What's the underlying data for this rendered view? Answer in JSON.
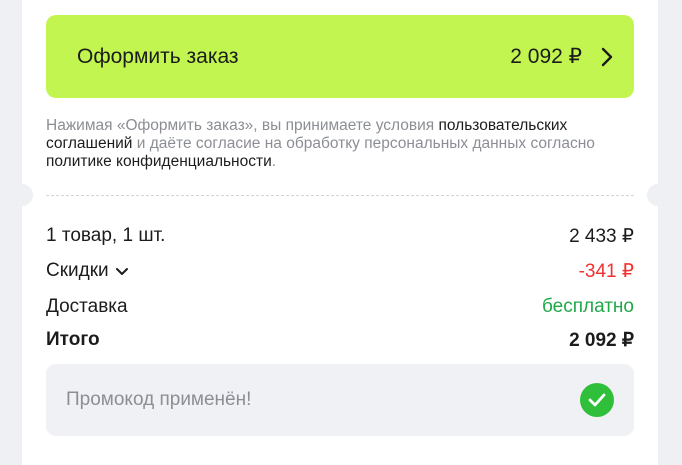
{
  "checkout": {
    "button_label": "Оформить заказ",
    "button_price": "2 092 ₽"
  },
  "agreement": {
    "part1": "Нажимая «Оформить заказ», вы принимаете условия ",
    "link1": "пользовательских соглашений",
    "part2": " и даёте согласие на обработку персональных данных согласно ",
    "link2": "политике конфиденциальности",
    "part3": "."
  },
  "summary": {
    "items_label": "1 товар, 1 шт.",
    "items_value": "2 433 ₽",
    "discount_label": "Скидки",
    "discount_value": "-341 ₽",
    "delivery_label": "Доставка",
    "delivery_value": "бесплатно",
    "total_label": "Итого",
    "total_value": "2 092 ₽"
  },
  "promo": {
    "text": "Промокод применён!"
  },
  "colors": {
    "accent": "#c2f54f",
    "discount": "#f1312e",
    "free": "#20a849",
    "success": "#2fbf3a"
  }
}
